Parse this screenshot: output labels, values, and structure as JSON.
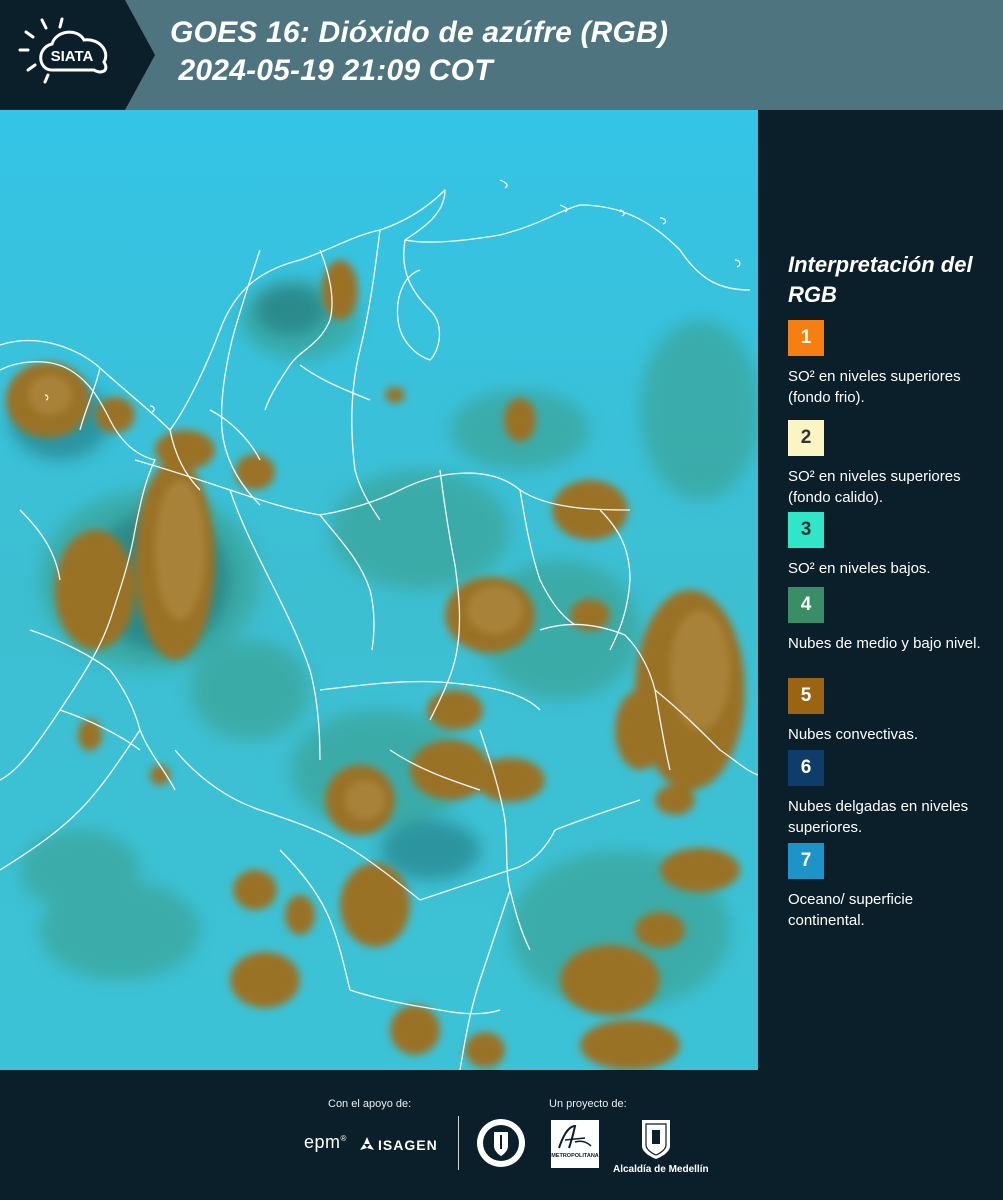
{
  "header": {
    "logo_text": "SIATA",
    "title_line1": "GOES 16: Dióxido de azúfre (RGB)",
    "title_line2": " 2024-05-19 21:09 COT",
    "background_color": "#4e7480"
  },
  "legend": {
    "title": "Interpretación del RGB",
    "items": [
      {
        "number": "1",
        "color": "#f57f10",
        "number_color": "#ffffff",
        "text": "SO² en niveles superiores (fondo frio)."
      },
      {
        "number": "2",
        "color": "#fbf5c4",
        "number_color": "#333333",
        "text": "SO² en niveles superiores (fondo calido)."
      },
      {
        "number": "3",
        "color": "#2fe6c6",
        "number_color": "#333333",
        "text": "SO² en niveles bajos."
      },
      {
        "number": "4",
        "color": "#3a8e67",
        "number_color": "#ffffff",
        "text": "Nubes de medio y bajo nivel."
      },
      {
        "number": "5",
        "color": "#9a6413",
        "number_color": "#ffffff",
        "text": "Nubes convectivas."
      },
      {
        "number": "6",
        "color": "#0f3d6b",
        "number_color": "#ffffff",
        "text": "Nubes delgadas en niveles superiores."
      },
      {
        "number": "7",
        "color": "#1e93c7",
        "number_color": "#ffffff",
        "text": "Oceano/ superficie continental."
      }
    ]
  },
  "footer": {
    "support_label": "Con el apoyo de:",
    "project_label": "Un proyecto de:",
    "epm": "epm",
    "isagen": "ISAGEN",
    "metropolitana": "METROPOLITANA",
    "alcaldia": "Alcaldía de Medellín"
  }
}
